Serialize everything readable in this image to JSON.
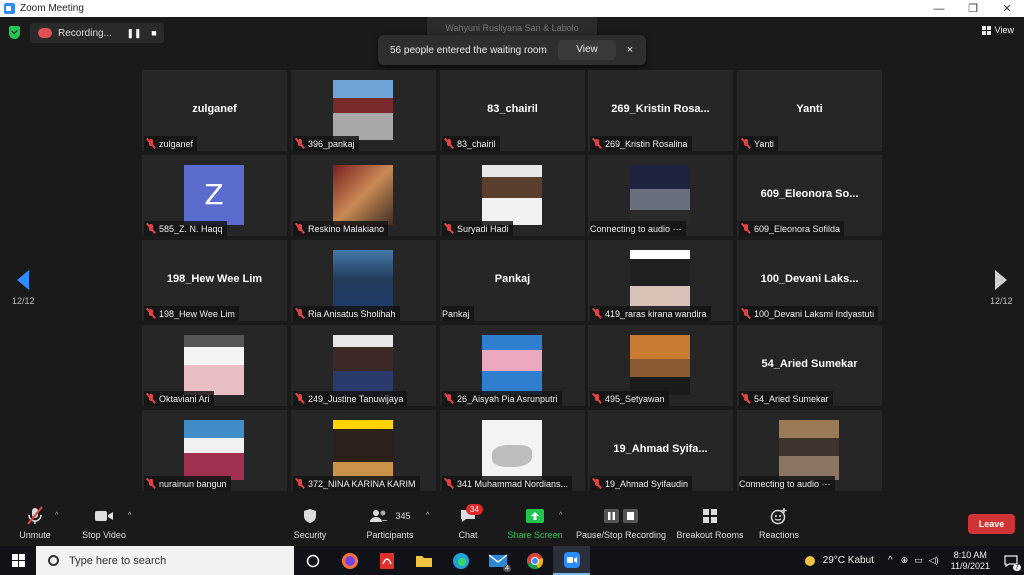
{
  "window": {
    "title": "Zoom Meeting"
  },
  "recording": {
    "label": "Recording..."
  },
  "speaker": {
    "name": "Wahyuni Rusliyana Sari & Labolo"
  },
  "view": {
    "label": "View"
  },
  "notification": {
    "message": "56 people entered the waiting room",
    "button": "View",
    "close": "×"
  },
  "page_indicator": {
    "left": "12/12",
    "right": "12/12"
  },
  "tiles": [
    {
      "big": "zulganef",
      "label": "zulganef"
    },
    {
      "big": "",
      "label": "396_pankaj"
    },
    {
      "big": "83_chairil",
      "label": "83_chairil"
    },
    {
      "big": "269_Kristin Rosa...",
      "label": "269_Kristin Rosalina"
    },
    {
      "big": "Yanti",
      "label": "Yanti"
    },
    {
      "big": "",
      "label": "585_Z. N. Haqq",
      "avatar_letter": "Z"
    },
    {
      "big": "",
      "label": "Reskino Malakiano"
    },
    {
      "big": "",
      "label": "Suryadi Hadi"
    },
    {
      "big": "",
      "label": "Connecting to audio ···"
    },
    {
      "big": "609_Eleonora So...",
      "label": "609_Eleonora Sofilda"
    },
    {
      "big": "198_Hew Wee Lim",
      "label": "198_Hew Wee Lim"
    },
    {
      "big": "",
      "label": "Ria Anisatus Sholihah"
    },
    {
      "big": "Pankaj",
      "label": "Pankaj"
    },
    {
      "big": "",
      "label": "419_raras kirana wandira"
    },
    {
      "big": "100_Devani Laks...",
      "label": "100_Devani Laksmi Indyastuti"
    },
    {
      "big": "",
      "label": "Oktaviani Ari"
    },
    {
      "big": "",
      "label": "249_Justine Tanuwijaya"
    },
    {
      "big": "",
      "label": "26_Aisyah Pia Asrunputri"
    },
    {
      "big": "",
      "label": "495_Setyawan"
    },
    {
      "big": "54_Aried Sumekar",
      "label": "54_Aried Sumekar"
    },
    {
      "big": "",
      "label": "nurainun bangun"
    },
    {
      "big": "",
      "label": "372_NINA KARINA KARIM"
    },
    {
      "big": "",
      "label": "341 Muhammad Nordians..."
    },
    {
      "big": "19_Ahmad Syifa...",
      "label": "19_Ahmad Syifaudin"
    },
    {
      "big": "",
      "label": "Connecting to audio ···"
    }
  ],
  "toolbar": {
    "unmute": "Unmute",
    "stop_video": "Stop Video",
    "security": "Security",
    "participants": "Participants",
    "participants_count": "345",
    "chat": "Chat",
    "chat_badge": "34",
    "share_screen": "Share Screen",
    "recording": "Pause/Stop Recording",
    "breakout": "Breakout Rooms",
    "reactions": "Reactions",
    "leave": "Leave"
  },
  "taskbar": {
    "search_placeholder": "Type here to search",
    "weather": "29°C  Kabut",
    "time": "8:10 AM",
    "date": "11/9/2021",
    "mail_badge": "4",
    "notif_badge": "7"
  },
  "colors": {
    "accent": "#2d8cff",
    "muted": "#e04343",
    "leave": "#d03434",
    "share": "#23c552"
  }
}
